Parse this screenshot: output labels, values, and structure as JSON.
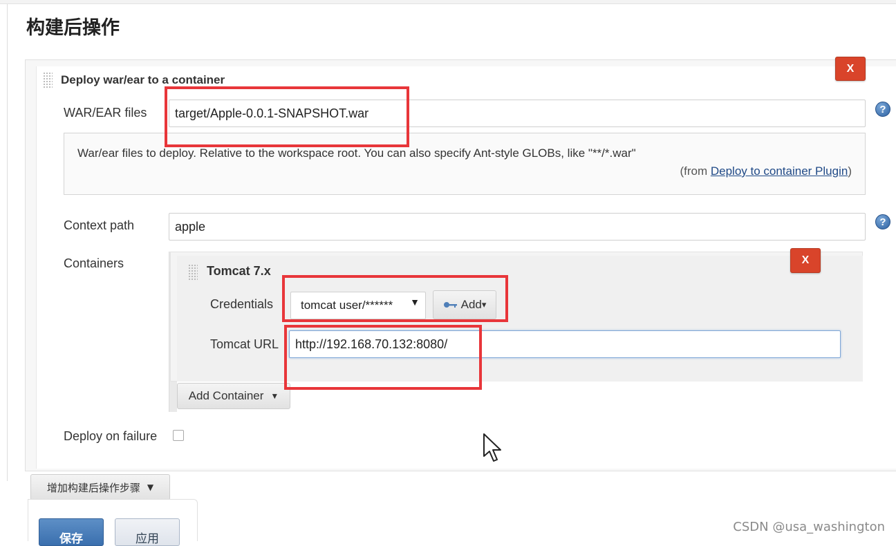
{
  "section_title": "构建后操作",
  "deploy_step": {
    "title": "Deploy war/ear to a container",
    "delete_label": "X",
    "war_files": {
      "label": "WAR/EAR files",
      "value": "target/Apple-0.0.1-SNAPSHOT.war"
    },
    "help": {
      "text": "War/ear files to deploy. Relative to the workspace root. You can also specify Ant-style GLOBs, like \"**/*.war\"",
      "from_prefix": "(from ",
      "link": "Deploy to container Plugin",
      "from_suffix": ")"
    },
    "context_path": {
      "label": "Context path",
      "value": "apple"
    },
    "containers": {
      "label": "Containers",
      "tomcat": {
        "title": "Tomcat 7.x",
        "delete_label": "X",
        "credentials_label": "Credentials",
        "credentials_value": "tomcat  user/******",
        "add_label": "Add",
        "url_label": "Tomcat URL",
        "url_value": "http://192.168.70.132:8080/"
      },
      "add_container_label": "Add Container"
    },
    "deploy_on_failure_label": "Deploy on failure"
  },
  "add_step_label": "增加构建后操作步骤",
  "save_label": "保存",
  "apply_label": "应用",
  "watermark": "CSDN @usa_washington",
  "colors": {
    "delete_button": "#d9442a",
    "highlight_box": "#e8363a",
    "help_icon": "#2f63a3",
    "link": "#204a87"
  }
}
